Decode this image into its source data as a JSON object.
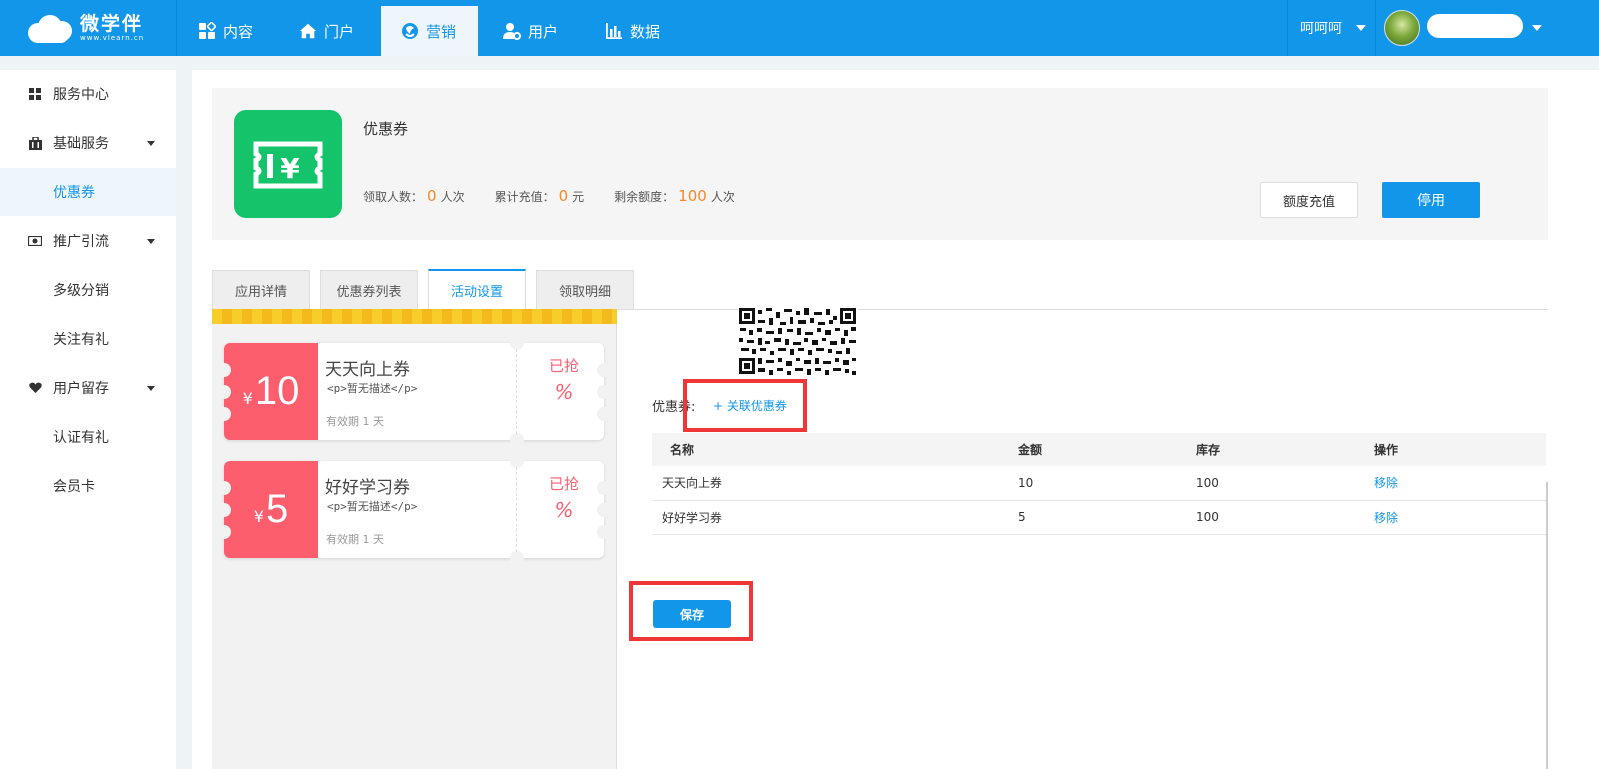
{
  "app": {
    "logo_name": "微学伴",
    "logo_url": "www.vlearn.cn"
  },
  "nav": {
    "items": [
      {
        "label": "内容",
        "icon": "grid-apps-icon"
      },
      {
        "label": "门户",
        "icon": "home-icon"
      },
      {
        "label": "营销",
        "icon": "marketing-swirl-icon"
      },
      {
        "label": "用户",
        "icon": "user-gear-icon"
      },
      {
        "label": "数据",
        "icon": "bar-chart-icon"
      }
    ],
    "active": "营销",
    "user_name": "呵呵呵"
  },
  "sidebar": {
    "items": [
      {
        "label": "服务中心",
        "icon": "grid-icon"
      },
      {
        "label": "基础服务",
        "icon": "briefcase-icon",
        "expandable": true
      },
      {
        "label": "优惠券",
        "active": true
      },
      {
        "label": "推广引流",
        "icon": "money-icon",
        "expandable": true
      },
      {
        "label": "多级分销"
      },
      {
        "label": "关注有礼"
      },
      {
        "label": "用户留存",
        "icon": "heart-icon",
        "expandable": true
      },
      {
        "label": "认证有礼"
      },
      {
        "label": "会员卡"
      }
    ]
  },
  "header": {
    "title": "优惠券",
    "stats": [
      {
        "label": "领取人数：",
        "value": "0",
        "unit": "人次"
      },
      {
        "label": "累计充值：",
        "value": "0",
        "unit": "元"
      },
      {
        "label": "剩余额度：",
        "value": "100",
        "unit": "人次"
      }
    ],
    "recharge_label": "额度充值",
    "disable_label": "停用"
  },
  "tabs": [
    {
      "label": "应用详情"
    },
    {
      "label": "优惠券列表"
    },
    {
      "label": "活动设置",
      "active": true
    },
    {
      "label": "领取明细"
    }
  ],
  "preview": {
    "coupons": [
      {
        "currency": "¥",
        "amount": "10",
        "name": "天天向上券",
        "desc": "<p>暂无描述</p>",
        "validity": "有效期 1 天",
        "grabbed": "已抢",
        "percent": "%"
      },
      {
        "currency": "¥",
        "amount": "5",
        "name": "好好学习券",
        "desc": "<p>暂无描述</p>",
        "validity": "有效期 1 天",
        "grabbed": "已抢",
        "percent": "%"
      }
    ]
  },
  "settings": {
    "coupon_label": "优惠券:",
    "associate_link": "+ 关联优惠券",
    "table": {
      "headers": [
        "名称",
        "金额",
        "库存",
        "操作"
      ],
      "rows": [
        {
          "name": "天天向上券",
          "amount": "10",
          "stock": "100",
          "action": "移除"
        },
        {
          "name": "好好学习券",
          "amount": "5",
          "stock": "100",
          "action": "移除"
        }
      ]
    },
    "save_label": "保存"
  },
  "colors": {
    "primary": "#1296ea",
    "coupon_red": "#fc5e6e",
    "app_icon_green": "#15c36a",
    "highlight_orange": "#f5892a",
    "annotation_red": "#f03737"
  }
}
